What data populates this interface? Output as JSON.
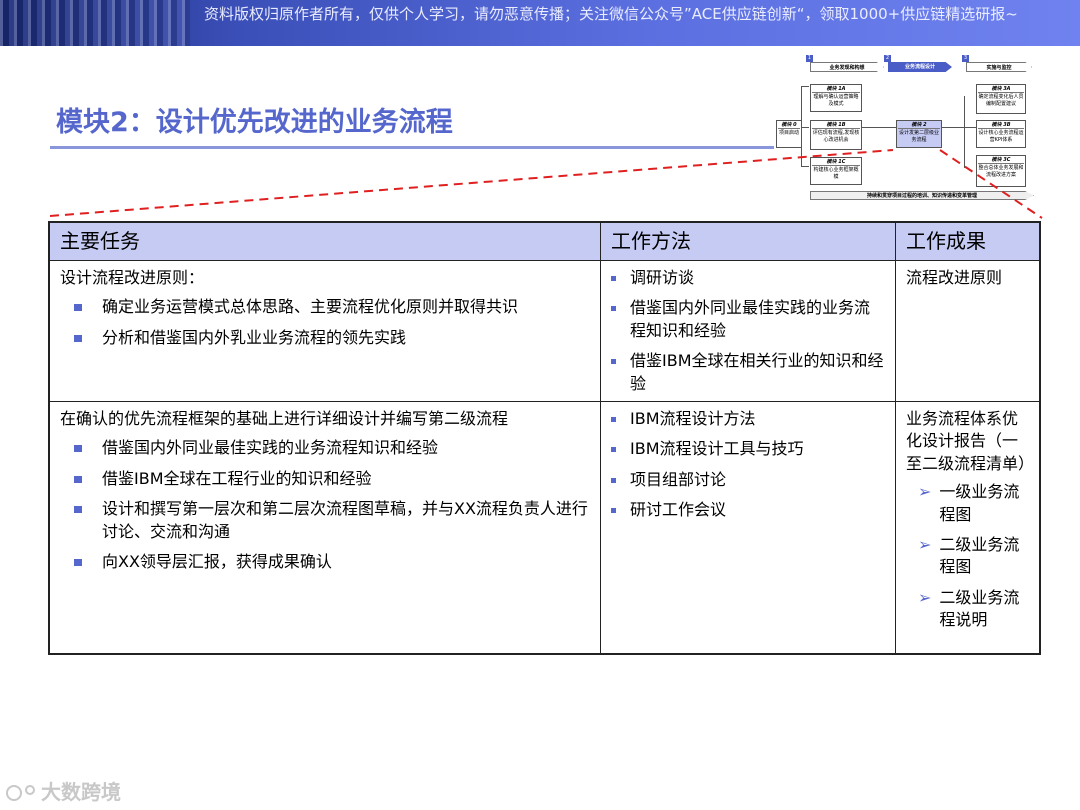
{
  "banner": {
    "text": "资料版权归原作者所有，仅供个人学习，请勿恶意传播；关注微信公众号”ACE供应链创新“，领取1000+供应链精选研报~"
  },
  "title": "模块2：设计优先改进的业务流程",
  "mini_diagram": {
    "phases": [
      {
        "num": "1",
        "label": "业务发现和构想"
      },
      {
        "num": "2",
        "label": "业务流程设计"
      },
      {
        "num": "3",
        "label": "实施与监控"
      }
    ],
    "module0": {
      "tag": "模块 0",
      "text": "项目启动"
    },
    "module1a": {
      "tag": "模块 1A",
      "text": "理解与确认运营策略及模式"
    },
    "module1b": {
      "tag": "模块 1B",
      "text": "评估现有流程,发现核心改进机会"
    },
    "module1c": {
      "tag": "模块 1C",
      "text": "构建核心业务框架概模"
    },
    "module2": {
      "tag": "模块 2",
      "text": "设计发第二层级业务流程"
    },
    "module3a": {
      "tag": "模块 3A",
      "text": "确定流程变化后人员编制配置建议"
    },
    "module3b": {
      "tag": "模块 3B",
      "text": "设计核心业务流程运营KPI体系"
    },
    "module3c": {
      "tag": "模块 3C",
      "text": "整合总体业务发展和流程改进方案"
    },
    "bottom_bar": "持续和贯穿项目过程的培训、知识传递和变革管理"
  },
  "table": {
    "headers": {
      "tasks": "主要任务",
      "methods": "工作方法",
      "results": "工作成果"
    },
    "rows": [
      {
        "task_title": "设计流程改进原则：",
        "task_points": [
          "确定业务运营模式总体思路、主要流程优化原则并取得共识",
          "分析和借鉴国内外乳业业务流程的领先实践"
        ],
        "methods": [
          "调研访谈",
          "借鉴国内外同业最佳实践的业务流程知识和经验",
          "借鉴IBM全球在相关行业的知识和经验"
        ],
        "result_title": "流程改进原则",
        "result_points": []
      },
      {
        "task_title": "在确认的优先流程框架的基础上进行详细设计并编写第二级流程",
        "task_points": [
          "借鉴国内外同业最佳实践的业务流程知识和经验",
          "借鉴IBM全球在工程行业的知识和经验",
          "设计和撰写第一层次和第二层次流程图草稿，并与XX流程负责人进行讨论、交流和沟通",
          "向XX领导层汇报，获得成果确认"
        ],
        "methods": [
          "IBM流程设计方法",
          "IBM流程设计工具与技巧",
          "项目组部讨论",
          "研讨工作会议"
        ],
        "result_title": "业务流程体系优化设计报告（一至二级流程清单）",
        "result_points": [
          "一级业务流程图",
          "二级业务流程图",
          "二级业务流程说明"
        ]
      }
    ]
  },
  "watermark": "大数跨境",
  "colors": {
    "accent": "#5566cc",
    "header_bg": "#c6cbf4",
    "dash": "#e02020"
  }
}
